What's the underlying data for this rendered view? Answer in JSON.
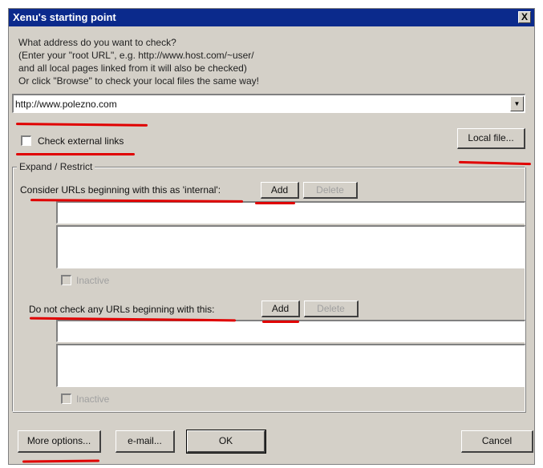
{
  "window": {
    "title": "Xenu's starting point",
    "close_glyph": "X"
  },
  "intro": {
    "line1": "What address do you want to check?",
    "line2": "(Enter your \"root URL\", e.g. http://www.host.com/~user/",
    "line3": "and all local pages linked from it will also be checked)",
    "line4": "Or click \"Browse\" to check your local files the same way!"
  },
  "url_combo": {
    "value": "http://www.polezno.com",
    "arrow_glyph": "▼"
  },
  "check_external": {
    "label": "Check external links",
    "checked": false
  },
  "local_file_button": "Local file...",
  "group": {
    "legend": "Expand / Restrict",
    "internal": {
      "label": "Consider URLs beginning with this as 'internal':",
      "add": "Add",
      "delete": "Delete",
      "inactive": "Inactive"
    },
    "exclude": {
      "label": "Do not check any URLs beginning with this:",
      "add": "Add",
      "delete": "Delete",
      "inactive": "Inactive"
    }
  },
  "footer": {
    "more_options": "More options...",
    "email": "e-mail...",
    "ok": "OK",
    "cancel": "Cancel"
  },
  "annotation_color": "#e00000"
}
